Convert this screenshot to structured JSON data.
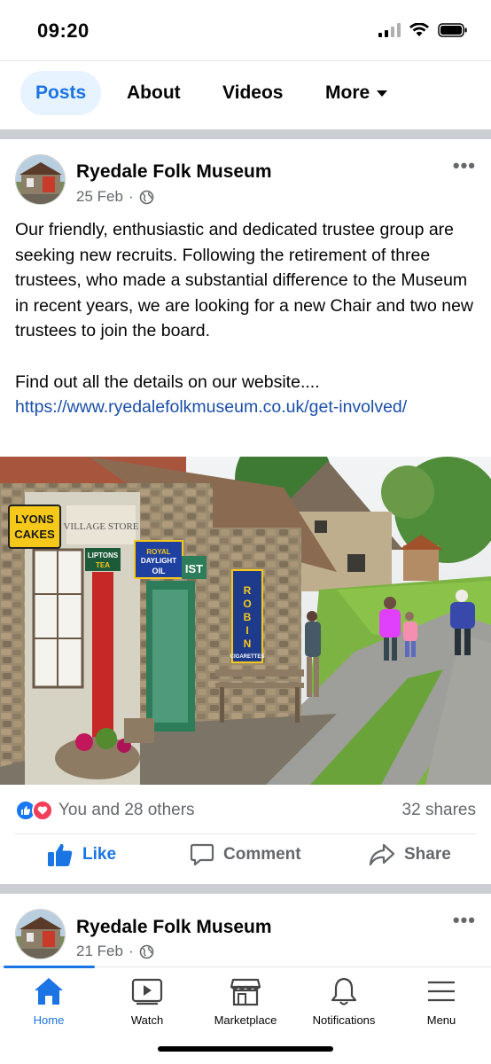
{
  "status_bar": {
    "time": "09:20"
  },
  "tabs": [
    {
      "label": "Posts",
      "active": true
    },
    {
      "label": "About",
      "active": false
    },
    {
      "label": "Videos",
      "active": false
    },
    {
      "label": "More",
      "active": false
    }
  ],
  "post": {
    "page_name": "Ryedale Folk Museum",
    "date": "25 Feb",
    "audience_icon": "globe-icon",
    "body": "Our friendly, enthusiastic and dedicated trustee group are seeking new recruits. Following the retirement of three trustees, who made a substantial difference to the Museum in recent years, we are looking for a new Chair and two new trustees to join the board.",
    "body2": "Find out all the details on our website....",
    "link": "https://www.ryedalefolkmuseum.co.uk/get-involved/",
    "image_signs": {
      "lyons": "LYONS CAKES",
      "village_store": "VILLAGE STORE",
      "liptons": "LIPTONS TEA",
      "royal_daylight": "ROYAL DAYLIGHT OIL",
      "robin": "ROBIN",
      "cigarettes": "CIGARETTES",
      "ist": "IST"
    },
    "reactions_text": "You and 28 others",
    "shares_text": "32 shares",
    "actions": {
      "like": "Like",
      "comment": "Comment",
      "share": "Share"
    }
  },
  "post2": {
    "page_name": "Ryedale Folk Museum",
    "date": "21 Feb"
  },
  "bottom_nav": [
    {
      "label": "Home",
      "icon": "home-icon",
      "active": true
    },
    {
      "label": "Watch",
      "icon": "watch-icon",
      "active": false
    },
    {
      "label": "Marketplace",
      "icon": "marketplace-icon",
      "active": false
    },
    {
      "label": "Notifications",
      "icon": "bell-icon",
      "active": false
    },
    {
      "label": "Menu",
      "icon": "menu-icon",
      "active": false
    }
  ],
  "colors": {
    "accent": "#1b74e4",
    "tab_active_bg": "#e7f3ff",
    "love": "#f33e58"
  }
}
